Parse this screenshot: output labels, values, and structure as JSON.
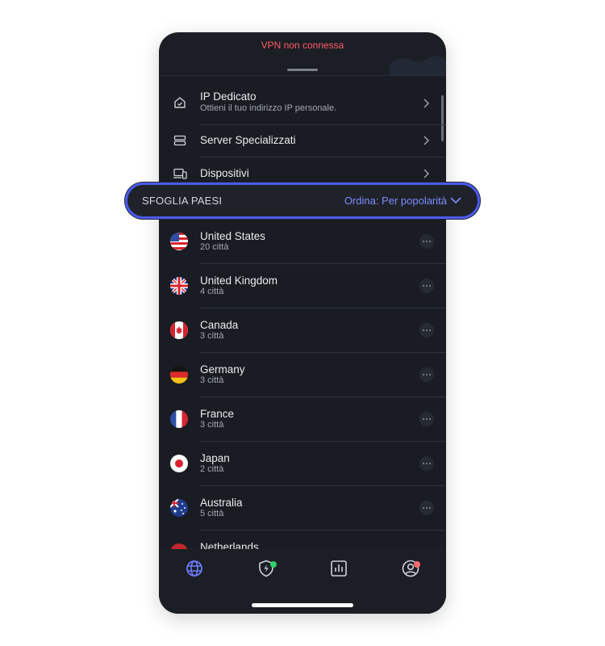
{
  "status": {
    "text": "VPN non connessa",
    "color": "#ff5a6a"
  },
  "menu": [
    {
      "icon": "home-shield-icon",
      "title": "IP Dedicato",
      "subtitle": "Ottieni il tuo indirizzo IP personale."
    },
    {
      "icon": "server-icon",
      "title": "Server Specializzati",
      "subtitle": ""
    },
    {
      "icon": "devices-icon",
      "title": "Dispositivi",
      "subtitle": ""
    }
  ],
  "browse": {
    "label": "SFOGLIA PAESI",
    "sort_label": "Ordina: Per popolarità",
    "accent": "#4b5af5"
  },
  "countries": [
    {
      "name": "United States",
      "cities": "20 città",
      "flag": "us-flag-icon"
    },
    {
      "name": "United Kingdom",
      "cities": "4 città",
      "flag": "uk-flag-icon"
    },
    {
      "name": "Canada",
      "cities": "3 città",
      "flag": "canada-flag-icon"
    },
    {
      "name": "Germany",
      "cities": "3 città",
      "flag": "germany-flag-icon"
    },
    {
      "name": "France",
      "cities": "3 città",
      "flag": "france-flag-icon"
    },
    {
      "name": "Japan",
      "cities": "2 città",
      "flag": "japan-flag-icon"
    },
    {
      "name": "Australia",
      "cities": "5 città",
      "flag": "australia-flag-icon"
    },
    {
      "name": "Netherlands",
      "cities": "",
      "flag": "netherlands-flag-icon"
    }
  ],
  "tabs": [
    {
      "icon": "globe-icon",
      "active": true
    },
    {
      "icon": "shield-bolt-icon",
      "badge_color": "#2fcf6b"
    },
    {
      "icon": "stats-icon"
    },
    {
      "icon": "profile-icon",
      "badge_color": "#ff6b6b"
    }
  ]
}
